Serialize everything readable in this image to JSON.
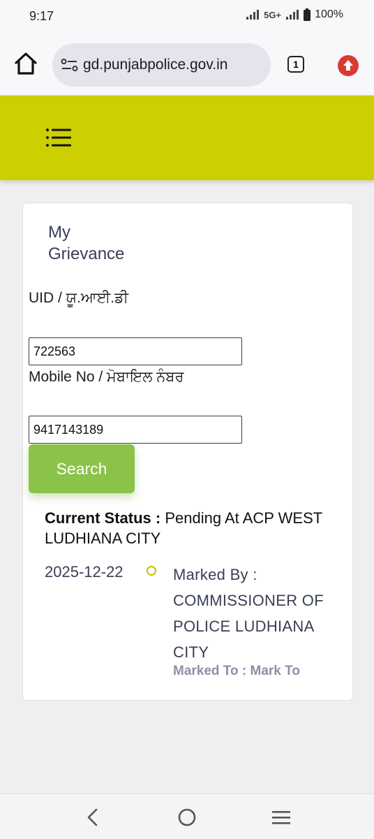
{
  "status_bar": {
    "time": "9:17",
    "network": "5G+",
    "battery": "100%"
  },
  "browser": {
    "url": "gd.punjabpolice.gov.in",
    "tab_count": "1"
  },
  "grievance": {
    "title_line1": "My",
    "title_line2": "Grievance",
    "uid_label": "UID / ਯੂ.ਆਈ.ਡੀ",
    "uid_value": "722563",
    "mobile_label": "Mobile No / ਮੋਬਾਇਲ ਨੰਬਰ",
    "mobile_value": "9417143189",
    "search_label": "Search"
  },
  "status": {
    "current_status_label": "Current Status :",
    "current_status_value": "Pending At ACP WEST LUDHIANA CITY"
  },
  "timeline": [
    {
      "date": "2025-12-22",
      "marked_by": "Marked By : COMMISSIONER OF POLICE LUDHIANA CITY",
      "marked_to": "Marked To : Mark To"
    }
  ],
  "colors": {
    "header_bg": "#cccf00",
    "search_button": "#8bc34a",
    "timeline_dot": "#c5c000"
  }
}
